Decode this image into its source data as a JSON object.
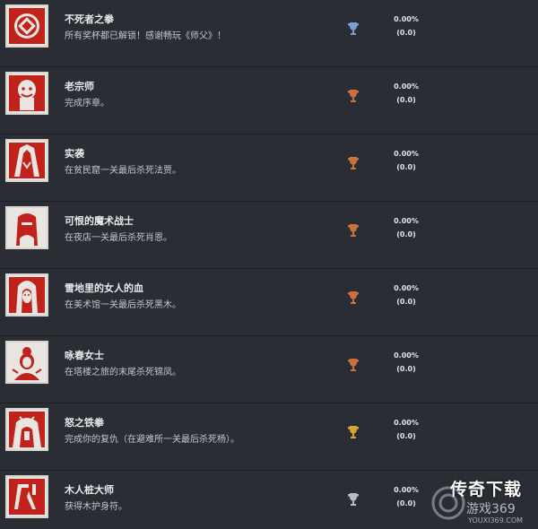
{
  "achievements": [
    {
      "title": "不死者之拳",
      "description": "所有奖杯都已解锁！感谢畅玩《师父》！",
      "trophy": "platinum",
      "trophy_color": "#7f9bd2",
      "icon": "fist-emblem-icon",
      "percent": "0.00%",
      "count": "(0.0)"
    },
    {
      "title": "老宗师",
      "description": "完成序章。",
      "trophy": "bronze",
      "trophy_color": "#c9713f",
      "icon": "old-master-portrait-icon",
      "percent": "0.00%",
      "count": "(0.0)"
    },
    {
      "title": "实袭",
      "description": "在贫民窟一关最后杀死法贾。",
      "trophy": "bronze",
      "trophy_color": "#c9713f",
      "icon": "fajar-portrait-icon",
      "percent": "0.00%",
      "count": "(0.0)"
    },
    {
      "title": "可恨的魔术战士",
      "description": "在夜店一关最后杀死肖恩。",
      "trophy": "bronze",
      "trophy_color": "#c9713f",
      "icon": "sean-portrait-icon",
      "percent": "0.00%",
      "count": "(0.0)"
    },
    {
      "title": "雪地里的女人的血",
      "description": "在美术馆一关最后杀死黑木。",
      "trophy": "bronze",
      "trophy_color": "#c9713f",
      "icon": "kuroki-portrait-icon",
      "percent": "0.00%",
      "count": "(0.0)"
    },
    {
      "title": "咏春女士",
      "description": "在塔楼之旅的末尾杀死锦凤。",
      "trophy": "bronze",
      "trophy_color": "#c9713f",
      "icon": "jinfeng-portrait-icon",
      "percent": "0.00%",
      "count": "(0.0)"
    },
    {
      "title": "怒之铁拳",
      "description": "完成你的复仇（在避难所一关最后杀死杨）。",
      "trophy": "gold",
      "trophy_color": "#d9a331",
      "icon": "yang-portrait-icon",
      "percent": "0.00%",
      "count": "(0.0)"
    },
    {
      "title": "木人桩大师",
      "description": "获得木护身符。",
      "trophy": "silver",
      "trophy_color": "#b8bcc2",
      "icon": "wooden-dummy-icon",
      "percent": "0.00%",
      "count": "(0.0)"
    }
  ],
  "watermark": {
    "title": "传奇下载",
    "subtitle": "游戏369",
    "url": "YOUXI369.COM"
  },
  "colors": {
    "background": "#24272e",
    "row": "#2a2d34",
    "icon_red": "#c1231c",
    "icon_bg": "#e9e6e2"
  }
}
